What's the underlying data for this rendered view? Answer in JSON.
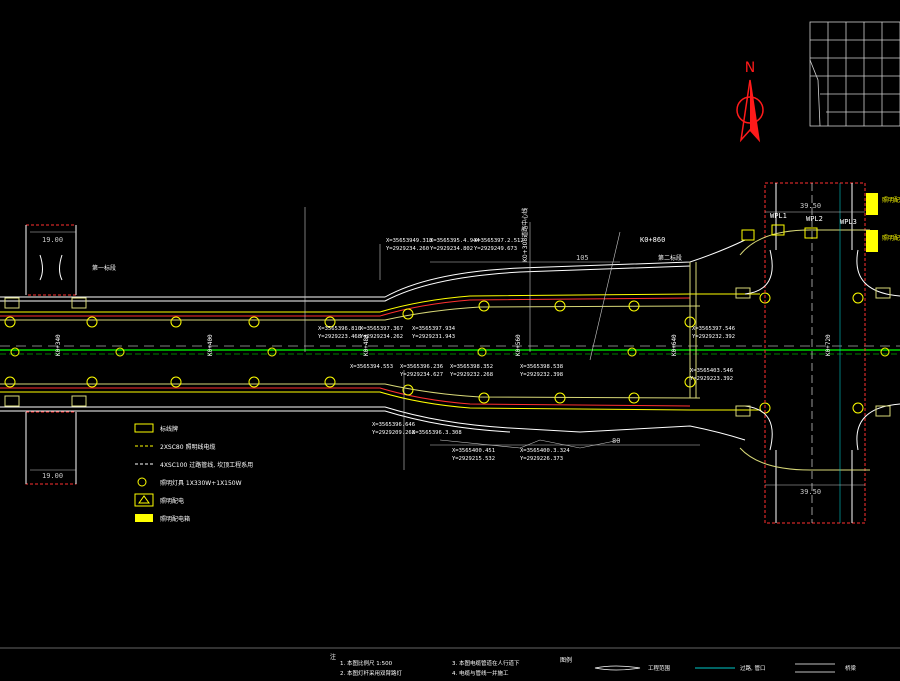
{
  "north": {
    "label": "N",
    "color": "#ff1a1a"
  },
  "colors": {
    "background": "#000000",
    "road_edge": "#ffffff",
    "center": "#00ff00",
    "lane_yellow": "#ffff00",
    "lane_red": "#ff3030",
    "cable": "#d8d878",
    "dim": "#c8c8c8",
    "cyan": "#00c8c8"
  },
  "dimensions": {
    "top_left": "19.00",
    "bottom_left": "19.00",
    "top_right": "39.50",
    "bottom_right": "39.50",
    "seg_105": "105",
    "seg_80": "80"
  },
  "marks": {
    "kplabel": "K0+860"
  },
  "coordinates": [
    "X=35653949.318",
    "X=3565395.4.944",
    "X=3565397.2.512",
    "Y=2929234.260",
    "Y=2929234.802",
    "Y=2929249.673",
    "X=3565396.810",
    "X=3565397.367",
    "X=3565397.934",
    "Y=2929223.468",
    "Y=2929234.262",
    "Y=2929231.943",
    "X=3565397.546",
    "Y=2929232.392",
    "X=3565394.553",
    "X=3565396.236",
    "X=3565398.352",
    "X=3565398.538",
    "Y=2929234.627",
    "Y=2929232.268",
    "Y=2929232.398",
    "X=3565403.546",
    "Y=2929223.392",
    "X=3565396.646",
    "X=3565396.3.308",
    "X=3565400.451",
    "X=3565400.3.324",
    "Y=2929209.268",
    "Y=2929215.532",
    "Y=2929226.373"
  ],
  "legend": [
    {
      "sym": "box",
      "text": "标线牌"
    },
    {
      "sym": "dash",
      "text": "2XSC80 照明线电缆"
    },
    {
      "sym": "dash2",
      "text": "4XSC100 过路管线, 坎顶工程系用"
    },
    {
      "sym": "lamp",
      "text": "照明灯具 1X330W+1X150W"
    },
    {
      "sym": "cabinet",
      "text": "照明配电"
    },
    {
      "sym": "solid",
      "text": "照明配电箱"
    }
  ],
  "footer": {
    "col1_title": "注",
    "col1_lines": [
      "1. 本图比例尺 1:500",
      "2. 本图灯杆采用双臂路灯"
    ],
    "col2_lines": [
      "3. 本图电缆管道在人行道下",
      "4. 电缆与管线一并施工"
    ],
    "col3_title": "图例",
    "col4_label": "工程范围",
    "col5_label": "过路, 管口",
    "col6_label": "桥梁"
  },
  "wpl": [
    "WPL1",
    "WPL2",
    "WPL3"
  ],
  "station_labels": [
    "K0+340",
    "K0+400",
    "K0+480",
    "K0+560",
    "K0+640",
    "K0+720"
  ],
  "notes": {
    "left_note": "第一标段",
    "right_note": "第二标段",
    "right_side": [
      "照明配电箱",
      "照明配电箱"
    ],
    "vert_text": "K0+308道路中心线"
  }
}
